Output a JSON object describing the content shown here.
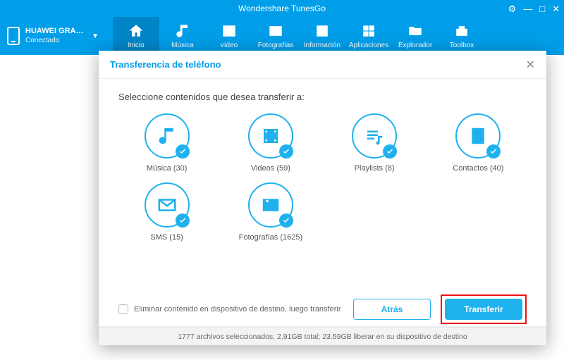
{
  "app": {
    "title": "Wondershare TunesGo"
  },
  "device": {
    "name": "HUAWEI GRA-T...",
    "status": "Conectado"
  },
  "nav": {
    "home": "Inicio",
    "music": "Música",
    "video": "vídeo",
    "photos": "Fotografías",
    "info": "Información",
    "apps": "Aplicaciones",
    "explorer": "Explorador",
    "toolbox": "Toolbox"
  },
  "dialog": {
    "title": "Transferencia de teléfono",
    "instruction": "Seleccione contenidos que desea transferir a:",
    "categories": {
      "music": {
        "label": "Música (30)"
      },
      "videos": {
        "label": "Videos (59)"
      },
      "playlists": {
        "label": "Playlists (8)"
      },
      "contacts": {
        "label": "Contactos (40)"
      },
      "sms": {
        "label": "SMS (15)"
      },
      "photos": {
        "label": "Fotografías (1625)"
      }
    },
    "deleteFirst": "Eliminar contenido en dispositivo de destino, luego transferir",
    "back": "Atrás",
    "transfer": "Transferir",
    "status": "1777 archivos seleccionados, 2.91GB total; 23.59GB liberar en su dispositivo de destino"
  }
}
